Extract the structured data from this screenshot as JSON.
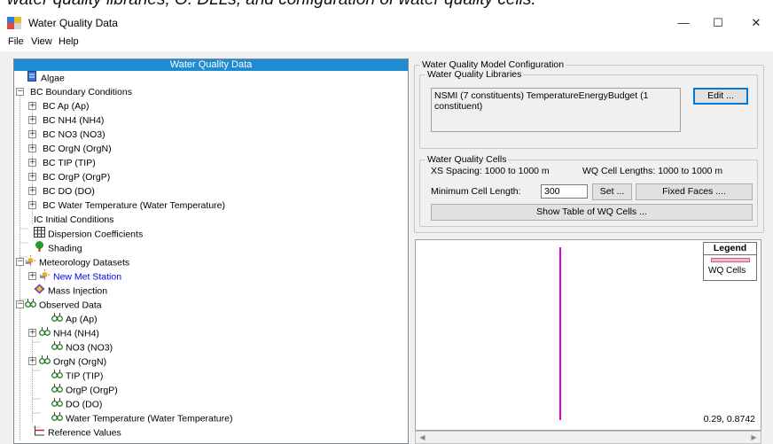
{
  "caption": "water quality libraries, O. DLLs, and configuration of water quality cells.",
  "window": {
    "title": "Water Quality Data",
    "minimize_glyph": "—",
    "maximize_glyph": "☐",
    "close_glyph": "✕"
  },
  "menu": [
    "File",
    "View",
    "Help"
  ],
  "tree": {
    "header": "Water Quality Data",
    "items": [
      {
        "label": "Algae",
        "icon": "document-icon"
      },
      {
        "label": "BC  Boundary Conditions",
        "expander": "−"
      },
      {
        "label": "BC  Ap  (Ap)",
        "expander": "+"
      },
      {
        "label": "BC  NH4  (NH4)",
        "expander": "+"
      },
      {
        "label": "BC  NO3  (NO3)",
        "expander": "+"
      },
      {
        "label": "BC  OrgN  (OrgN)",
        "expander": "+"
      },
      {
        "label": "BC  TIP  (TIP)",
        "expander": "+"
      },
      {
        "label": "BC  OrgP  (OrgP)",
        "expander": "+"
      },
      {
        "label": "BC  DO  (DO)",
        "expander": "+"
      },
      {
        "label": "BC  Water Temperature  (Water Temperature)",
        "expander": "+"
      },
      {
        "label": "IC  Initial Conditions"
      },
      {
        "label": "Dispersion Coefficients",
        "icon": "table-icon"
      },
      {
        "label": "Shading",
        "icon": "tree-icon"
      },
      {
        "label": "Meteorology Datasets",
        "icon": "weather-icon",
        "expander": "−"
      },
      {
        "label": "New Met Station",
        "icon": "weather-icon",
        "expander": "+",
        "color": "#0000ee"
      },
      {
        "label": "Mass Injection",
        "icon": "diamond-icon"
      },
      {
        "label": "Observed Data",
        "icon": "binoculars-icon",
        "expander": "−"
      },
      {
        "label": "Ap (Ap)",
        "icon": "binoculars-icon"
      },
      {
        "label": "NH4 (NH4)",
        "icon": "binoculars-icon",
        "expander": "+"
      },
      {
        "label": "NO3 (NO3)",
        "icon": "binoculars-icon"
      },
      {
        "label": "OrgN (OrgN)",
        "icon": "binoculars-icon",
        "expander": "+"
      },
      {
        "label": "TIP (TIP)",
        "icon": "binoculars-icon"
      },
      {
        "label": "OrgP (OrgP)",
        "icon": "binoculars-icon"
      },
      {
        "label": "DO (DO)",
        "icon": "binoculars-icon"
      },
      {
        "label": "Water Temperature (Water Temperature)",
        "icon": "binoculars-icon"
      },
      {
        "label": "Reference Values",
        "icon": "reference-icon"
      }
    ]
  },
  "config": {
    "group_title": "Water Quality Model Configuration",
    "libraries": {
      "title": "Water Quality Libraries",
      "text": "NSMI (7 constituents)  TemperatureEnergyBudget (1 constituent)",
      "edit_label": "Edit ..."
    },
    "cells": {
      "title": "Water Quality Cells",
      "xs_spacing": "XS Spacing: 1000 to 1000 m",
      "cell_lengths": "WQ Cell Lengths: 1000 to 1000 m",
      "min_cell_label": "Minimum Cell Length:",
      "min_cell_value": "300",
      "set_label": "Set ...",
      "fixed_faces_label": "Fixed Faces ....",
      "show_table_label": "Show Table of WQ Cells ..."
    }
  },
  "plot": {
    "legend_title": "Legend",
    "legend_item": "WQ Cells",
    "line_color": "#e000e0",
    "coordinates": "0.29, 0.8742"
  }
}
